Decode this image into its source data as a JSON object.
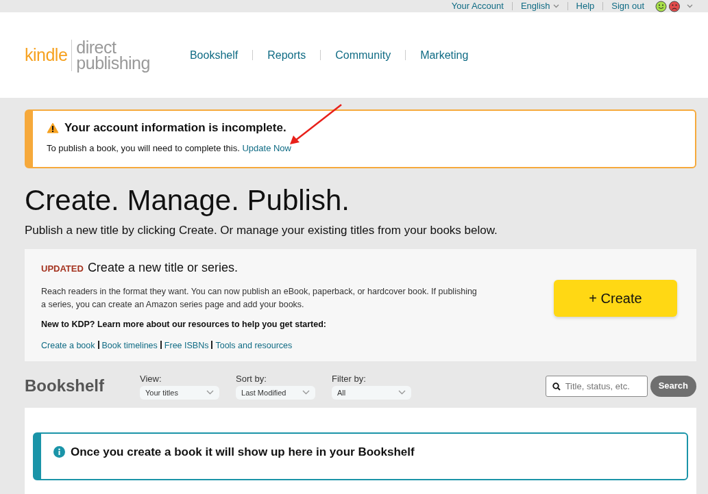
{
  "top_links": [
    {
      "label": "Your Account",
      "kind": "link"
    },
    {
      "label": "English",
      "kind": "dropdown"
    },
    {
      "label": "Help",
      "kind": "link"
    },
    {
      "label": "Sign out",
      "kind": "link"
    }
  ],
  "logo": {
    "brand": "kindle",
    "line_1": "direct",
    "line_2": "publishing"
  },
  "nav": [
    "Bookshelf",
    "Reports",
    "Community",
    "Marketing"
  ],
  "alert": {
    "title": "Your account information is incomplete.",
    "text": "To publish a book, you will need to complete this.",
    "link": "Update Now"
  },
  "heading": "Create. Manage. Publish.",
  "subheading": "Publish a new title by clicking Create. Or manage your existing titles from your books below.",
  "create_panel": {
    "badge": "UPDATED",
    "title": "Create a new title or series.",
    "description": "Reach readers in the format they want. You can now publish an eBook, paperback, or hardcover book. If publishing a series, you can create an Amazon series page and add your books.",
    "resources_heading": "New to KDP? Learn more about our resources to help you get started:",
    "links": [
      "Create a book",
      "Book timelines",
      "Free ISBNs",
      "Tools and resources"
    ],
    "button": "+ Create"
  },
  "bookshelf": {
    "title": "Bookshelf",
    "filters": [
      {
        "label": "View:",
        "value": "Your titles"
      },
      {
        "label": "Sort by:",
        "value": "Last Modified"
      },
      {
        "label": "Filter by:",
        "value": "All"
      }
    ],
    "search": {
      "placeholder": "Title, status, etc."
    },
    "search_button": "Search"
  },
  "info": {
    "text": "Once you create a book it will show up here in your Bookshelf"
  }
}
